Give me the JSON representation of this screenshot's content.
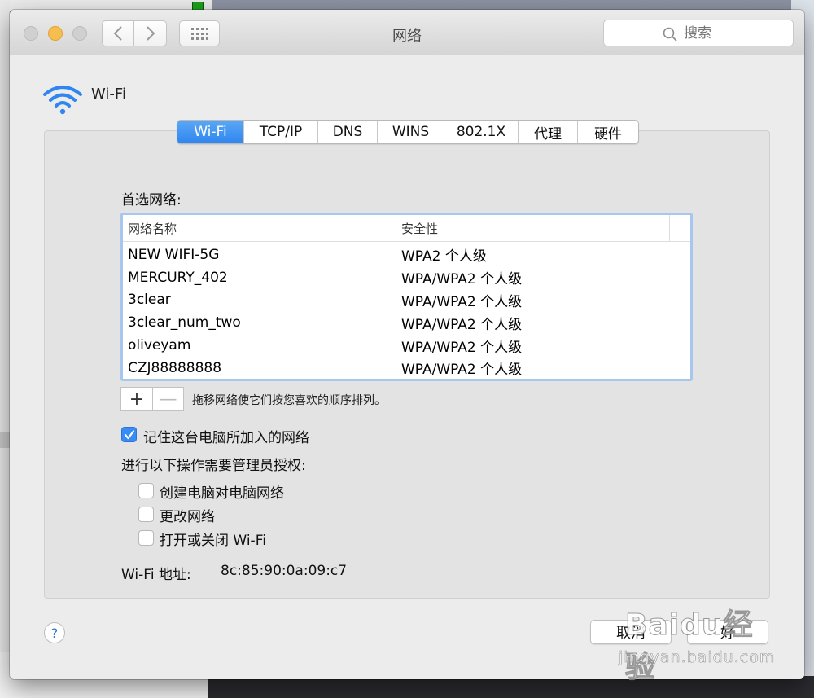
{
  "window": {
    "title": "网络",
    "search_placeholder": "搜索"
  },
  "header": {
    "label": "Wi-Fi"
  },
  "tabs": [
    {
      "label": "Wi-Fi",
      "active": true
    },
    {
      "label": "TCP/IP",
      "active": false
    },
    {
      "label": "DNS",
      "active": false
    },
    {
      "label": "WINS",
      "active": false
    },
    {
      "label": "802.1X",
      "active": false
    },
    {
      "label": "代理",
      "active": false
    },
    {
      "label": "硬件",
      "active": false
    }
  ],
  "preferred": {
    "label": "首选网络:",
    "columns": [
      "网络名称",
      "安全性"
    ],
    "rows": [
      {
        "name": "NEW WIFI-5G",
        "security": "WPA2 个人级"
      },
      {
        "name": "MERCURY_402",
        "security": "WPA/WPA2 个人级"
      },
      {
        "name": "3clear",
        "security": "WPA/WPA2 个人级"
      },
      {
        "name": "3clear_num_two",
        "security": "WPA/WPA2 个人级"
      },
      {
        "name": "oliveyam",
        "security": "WPA/WPA2 个人级"
      },
      {
        "name": "CZJ88888888",
        "security": "WPA/WPA2 个人级"
      }
    ],
    "add_label": "+",
    "remove_label": "—",
    "drag_hint": "拖移网络使它们按您喜欢的顺序排列。"
  },
  "options": {
    "remember_label": "记住这台电脑所加入的网络",
    "remember_checked": true,
    "admin_label": "进行以下操作需要管理员授权:",
    "admin_items": [
      {
        "label": "创建电脑对电脑网络",
        "checked": false
      },
      {
        "label": "更改网络",
        "checked": false
      },
      {
        "label": "打开或关闭 Wi-Fi",
        "checked": false
      }
    ]
  },
  "address": {
    "label": "Wi-Fi 地址:",
    "value": "8c:85:90:0a:09:c7"
  },
  "footer": {
    "help_label": "?",
    "cancel_label": "取消",
    "ok_label": "好"
  },
  "watermark": {
    "main": "Baidu经验",
    "sub": "jingyan.baidu.com"
  },
  "colors": {
    "accent": "#2f86ef",
    "traffic_min": "#f5be4f",
    "table_focus": "#a7c7ee"
  }
}
